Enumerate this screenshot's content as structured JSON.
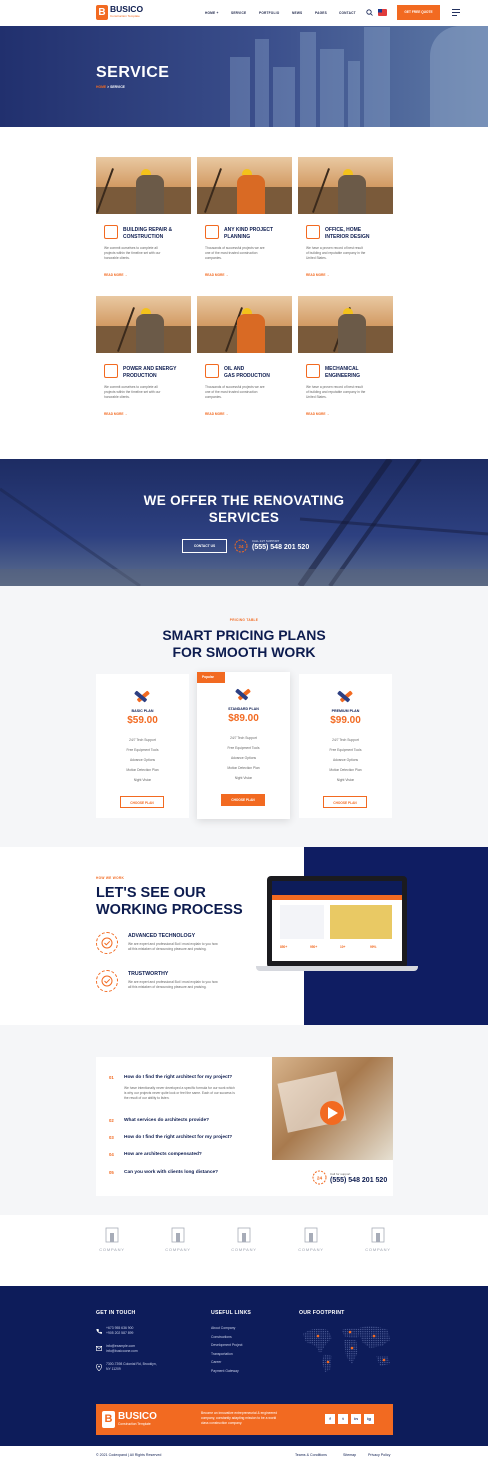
{
  "header": {
    "logo_title": "BUSICO",
    "logo_subtitle": "Construction Template",
    "nav": [
      "HOME +",
      "SERVICE",
      "PORTFOLIO",
      "NEWS",
      "PAGES",
      "CONTACT"
    ],
    "cta_label": "GET FREE QUOTE"
  },
  "hero": {
    "title": "SERVICE",
    "breadcrumb_home": "HOME",
    "breadcrumb_sep": ">",
    "breadcrumb_current": "SERVICE"
  },
  "services": {
    "read_more": "READ MORE",
    "items": [
      {
        "title_1": "BUILDING REPAIR &",
        "title_2": "CONSTRUCTION",
        "text_1": "We commit ourselves to complete all",
        "text_2": "projects within the timeline set with our",
        "text_3": "honorable clients."
      },
      {
        "title_1": "ANY KIND PROJECT",
        "title_2": "PLANNING",
        "text_1": "Thousands of successful projects we are",
        "text_2": "one of the most trusted construction",
        "text_3": "companies."
      },
      {
        "title_1": "OFFICE, HOME",
        "title_2": "INTERIOR DESIGN",
        "text_1": "We have a proven record of best result",
        "text_2": "of building and reputable company in the",
        "text_3": "United States."
      },
      {
        "title_1": "POWER AND ENERGY",
        "title_2": "PRODUCTION",
        "text_1": "We commit ourselves to complete all",
        "text_2": "projects within the timeline set with our",
        "text_3": "honorable clients."
      },
      {
        "title_1": "OIL AND",
        "title_2": "GAS PRODUCTION",
        "text_1": "Thousands of successful projects we are",
        "text_2": "one of the most trusted construction",
        "text_3": "companies."
      },
      {
        "title_1": "MECHANICAL",
        "title_2": "ENGINEERING",
        "text_1": "We have a proven record of best result",
        "text_2": "of building and reputable company in the",
        "text_3": "United States."
      }
    ]
  },
  "cta": {
    "title_1": "WE OFFER THE RENOVATING",
    "title_2": "SERVICES",
    "button": "CONTACT US",
    "support_label": "CALL 24/7 SUPPORT",
    "phone": "(555) 548 201 520"
  },
  "pricing": {
    "eyebrow": "PRICING TABLE",
    "title_1": "SMART PRICING PLANS",
    "title_2": "FOR SMOOTH WORK",
    "badge": "Popular",
    "features": [
      "24/7 Tech Support",
      "Free Equipment Tools",
      "Advance Options",
      "Motion Detection Plan",
      "Night Vision"
    ],
    "button": "CHOOSE PLAN",
    "plans": [
      {
        "name": "BASIC PLAN",
        "price": "$59.00"
      },
      {
        "name": "STANDARD PLAN",
        "price": "$89.00"
      },
      {
        "name": "PREMIUM PLAN",
        "price": "$99.00"
      }
    ]
  },
  "process": {
    "eyebrow": "HOW WE WORK",
    "title_1": "LET'S SEE OUR",
    "title_2": "WORKING PROCESS",
    "items": [
      {
        "title": "ADVANCED TECHNOLOGY",
        "text_1": "We are expert and professional But I must explain to you how",
        "text_2": "all this mistaken of denouncing pleasure and praising."
      },
      {
        "title": "TRUSTWORTHY",
        "text_1": "We are expert and professional But I must explain to you how",
        "text_2": "all this mistaken of denouncing pleasure and praising."
      }
    ],
    "laptop_stats": [
      "850+",
      "950+",
      "10+",
      "99%"
    ]
  },
  "faq": {
    "items": [
      {
        "num": "01",
        "q": "How do I find the right architect for my project?"
      },
      {
        "num": "02",
        "q": "What services do architects provide?"
      },
      {
        "num": "03",
        "q": "How do I find the right architect for my project?"
      },
      {
        "num": "04",
        "q": "How are architects compensated?"
      },
      {
        "num": "05",
        "q": "Can you work with clients long distance?"
      }
    ],
    "answer_1": "We have intentionally never developed a specific formula for our work which",
    "answer_2": "is why our projects never quite look or feel the same. Each of our success is",
    "answer_3": "the result of our ability to listen.",
    "call_label": "Call for support",
    "phone": "(555) 548 201 520"
  },
  "partners": [
    "COMPANY",
    "COMPANY",
    "COMPANY",
    "COMPANY",
    "COMPANY"
  ],
  "footer": {
    "col1_title": "GET IN TOUCH",
    "phone_1": "+673 955 636 900",
    "phone_2": "+905 202 587 899",
    "email_1": "info@example.com",
    "email_2": "info@busicoone.com",
    "address_1": "7300-7398 Colonial Rd, Brooklyn,",
    "address_2": "NY 11209",
    "col2_title": "USEFUL LINKS",
    "links": [
      "About Company",
      "Constructions",
      "Development Project",
      "Transportation",
      "Career",
      "Payment Gateway"
    ],
    "col3_title": "OUR FOOTPRINT",
    "brand_title": "BUSICO",
    "brand_sub": "Construction Template",
    "brand_text_1": "Become an innovative entrepreneurial & engineered",
    "brand_text_2": "company, constantly adapting mission to be a world",
    "brand_text_3": "class construction company.",
    "socials": [
      "f",
      "t",
      "in",
      "ig"
    ],
    "copyright": "© 2021 Codexpand | All Rights Reserved",
    "bottom_links": [
      "Teams & Conditions",
      "Sitemap",
      "Privacy Policy"
    ]
  },
  "colors": {
    "accent": "#f26a21",
    "navy": "#0d1c5a",
    "hero": "#21306e"
  }
}
